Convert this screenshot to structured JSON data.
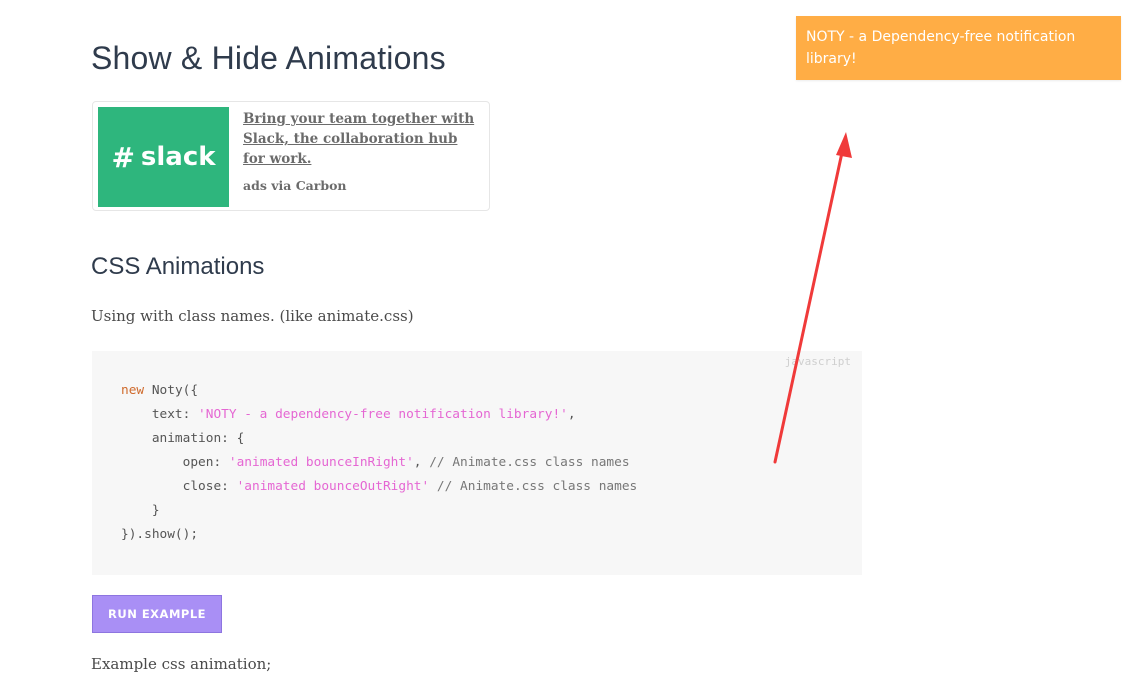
{
  "page": {
    "title": "Show & Hide Animations"
  },
  "ad": {
    "logo_text": "slack",
    "link_text": "Bring your team together with Slack, the collaboration hub for work.",
    "via_text": "ads via Carbon"
  },
  "section": {
    "title": "CSS Animations",
    "intro": "Using with class names. (like animate.css)"
  },
  "code": {
    "language": "javascript",
    "kw_new": "new",
    "l1_rest": " Noty({",
    "l2_key": "    text: ",
    "l2_str": "'NOTY - a dependency-free notification library!'",
    "l2_end": ",",
    "l3": "    animation: {",
    "l4_key": "        open: ",
    "l4_str": "'animated bounceInRight'",
    "l4_sep": ", ",
    "l4_cm": "// Animate.css class names",
    "l5_key": "        close: ",
    "l5_str": "'animated bounceOutRight'",
    "l5_sep": " ",
    "l5_cm": "// Animate.css class names",
    "l6": "    }",
    "l7": "}).show();"
  },
  "run_button": {
    "label": "RUN EXAMPLE"
  },
  "example_text": "Example css animation;",
  "notification": {
    "text": "NOTY - a Dependency-free notification library!"
  },
  "colors": {
    "notification_bg": "#ffad45",
    "button_bg": "#a98ff5",
    "arrow": "#f03a3a",
    "slack_green": "#2eb67d"
  }
}
